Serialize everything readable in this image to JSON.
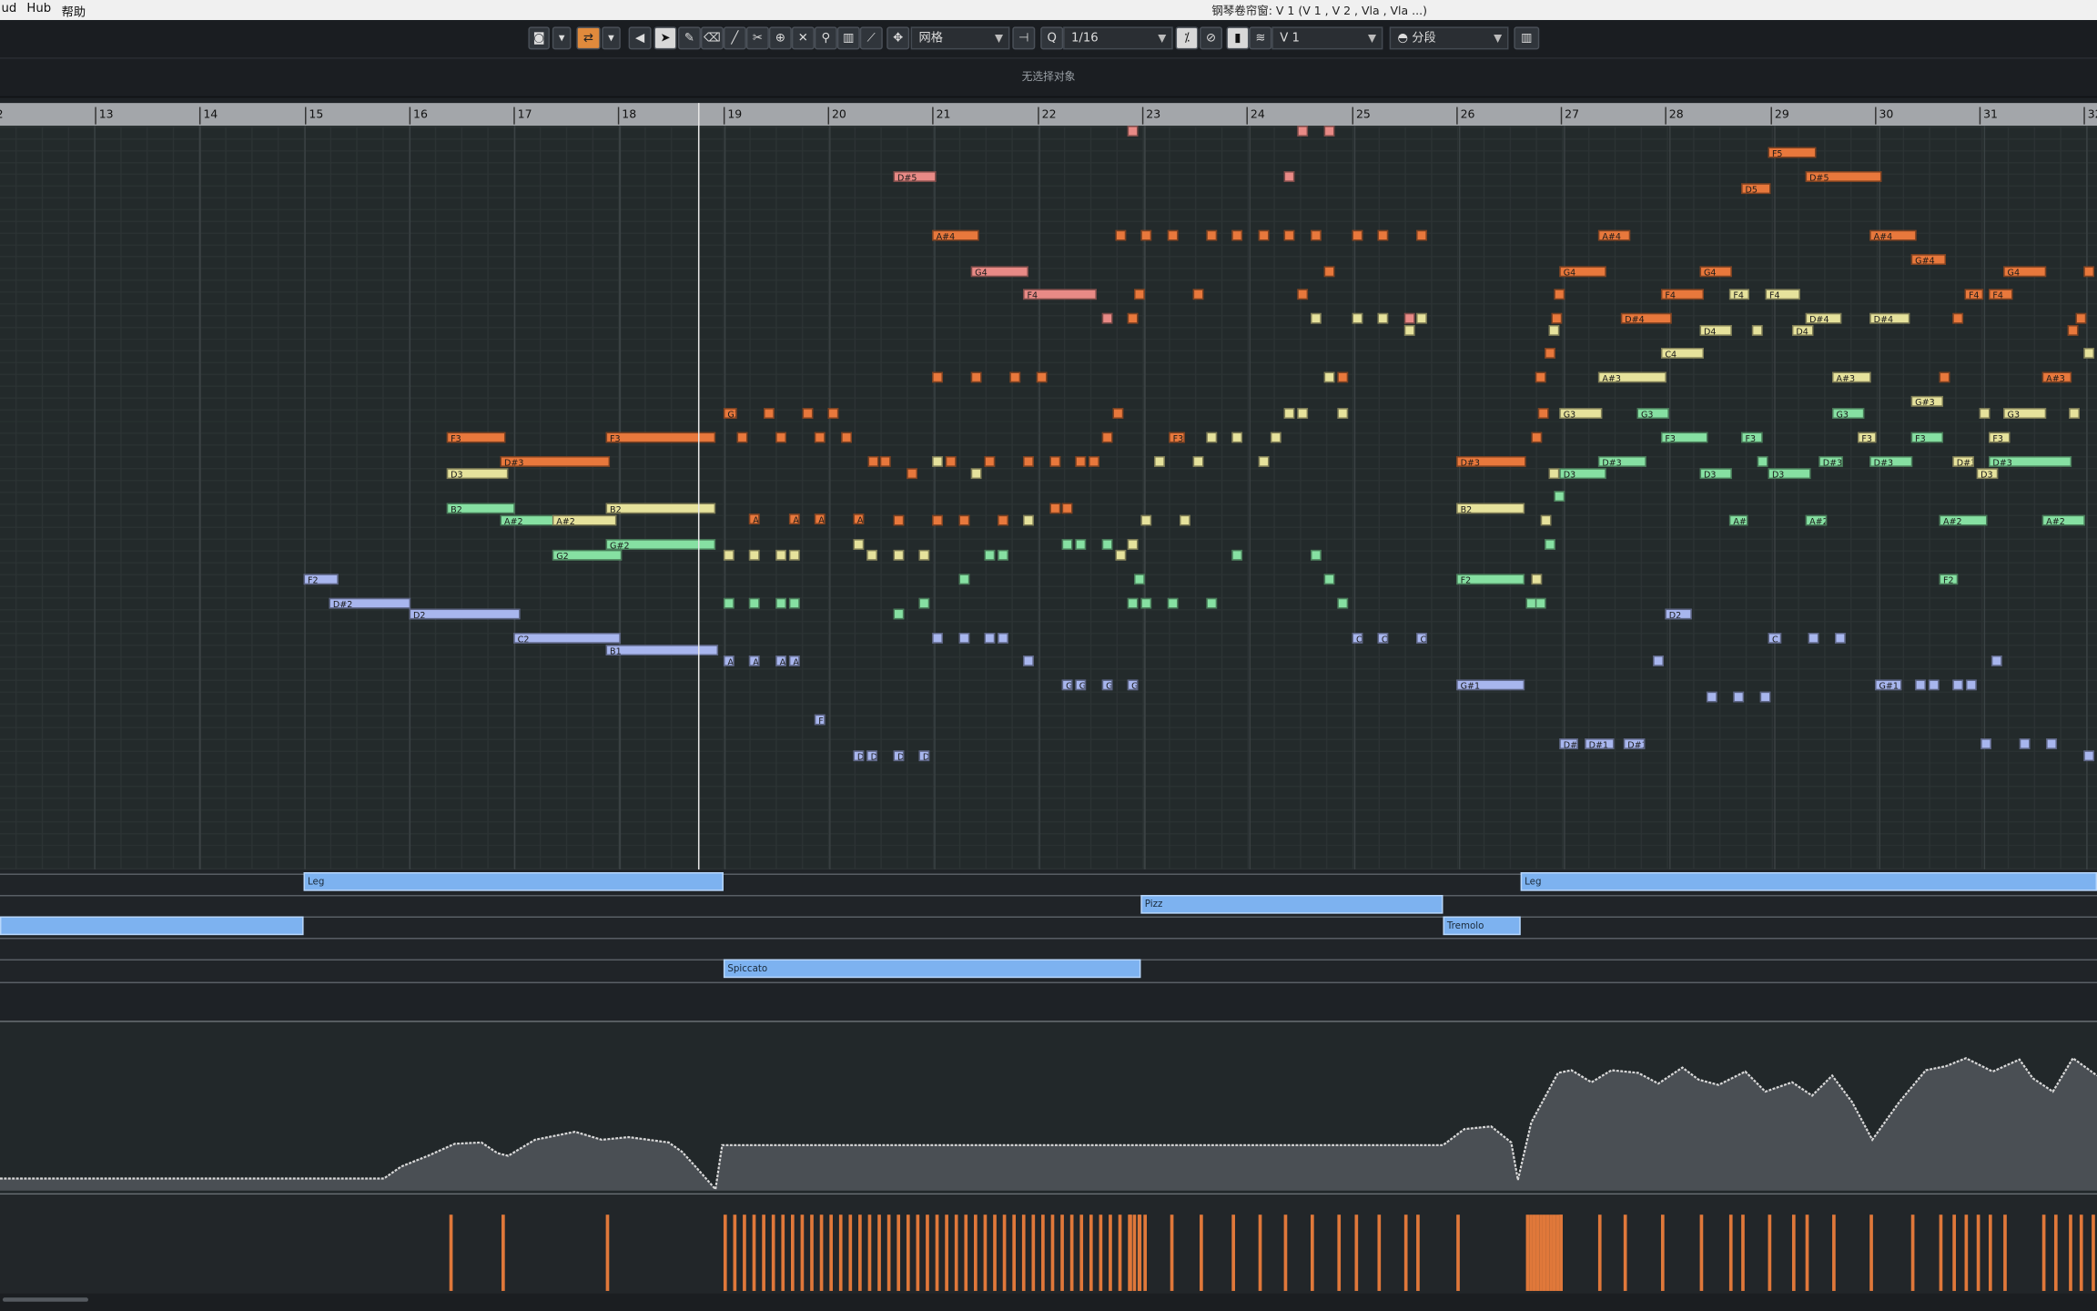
{
  "menu": {
    "items": [
      "ud",
      "Hub",
      "帮助"
    ]
  },
  "window_title": "钢琴卷帘窗: V 1 (V 1 , V 2 , Vla , Vla ...)",
  "toolbar": {
    "grid_label": "网格",
    "quantize_value": "1/16",
    "track_value": "V 1",
    "segment_label": "分段"
  },
  "info": {
    "status": "无选择对象"
  },
  "ruler": {
    "bars": [
      "2",
      "13",
      "14",
      "15",
      "16",
      "17",
      "18",
      "19",
      "20",
      "21",
      "22",
      "23",
      "24",
      "25",
      "26",
      "27",
      "28",
      "29",
      "30",
      "31",
      "32"
    ]
  },
  "articulations": {
    "labels": [
      "Leg",
      "Pizz",
      "Tremolo",
      "Spiccato",
      "Leg"
    ]
  },
  "colors": {
    "orange": "#e8783c",
    "pink": "#e88a86",
    "yellow": "#e6e29c",
    "green": "#86e0a2",
    "blue": "#a8b6ee",
    "articulation": "#7db2f0",
    "playhead": "#e8e8e8"
  },
  "notes": [
    {
      "label": "F3",
      "color": "orange"
    },
    {
      "label": "F3",
      "color": "orange"
    },
    {
      "label": "D#3",
      "color": "orange"
    },
    {
      "label": "D3",
      "color": "yellow"
    },
    {
      "label": "B2",
      "color": "green"
    },
    {
      "label": "B2",
      "color": "yellow"
    },
    {
      "label": "A#2",
      "color": "green"
    },
    {
      "label": "A#2",
      "color": "yellow"
    },
    {
      "label": "G#2",
      "color": "green"
    },
    {
      "label": "G2",
      "color": "green"
    },
    {
      "label": "F2",
      "color": "blue"
    },
    {
      "label": "D#2",
      "color": "blue"
    },
    {
      "label": "D2",
      "color": "blue"
    },
    {
      "label": "C2",
      "color": "blue"
    },
    {
      "label": "B1",
      "color": "blue"
    },
    {
      "label": "D#5",
      "color": "pink"
    },
    {
      "label": "A#4",
      "color": "orange"
    },
    {
      "label": "G4",
      "color": "pink"
    },
    {
      "label": "F4",
      "color": "pink"
    },
    {
      "label": "F5",
      "color": "orange"
    },
    {
      "label": "D#5",
      "color": "orange"
    },
    {
      "label": "D5",
      "color": "orange"
    },
    {
      "label": "A#4",
      "color": "orange"
    },
    {
      "label": "A#4",
      "color": "orange"
    },
    {
      "label": "G#4",
      "color": "orange"
    },
    {
      "label": "G4",
      "color": "orange"
    },
    {
      "label": "G4",
      "color": "orange"
    },
    {
      "label": "G4",
      "color": "orange"
    },
    {
      "label": "F4",
      "color": "orange"
    },
    {
      "label": "F4",
      "color": "yellow"
    },
    {
      "label": "F4",
      "color": "yellow"
    },
    {
      "label": "F4",
      "color": "orange"
    },
    {
      "label": "F4",
      "color": "orange"
    },
    {
      "label": "D#4",
      "color": "orange"
    },
    {
      "label": "D#4",
      "color": "yellow"
    },
    {
      "label": "D#4",
      "color": "yellow"
    },
    {
      "label": "D4",
      "color": "yellow"
    },
    {
      "label": "D4",
      "color": "yellow"
    },
    {
      "label": "C4",
      "color": "yellow"
    },
    {
      "label": "A#3",
      "color": "yellow"
    },
    {
      "label": "A#3",
      "color": "yellow"
    },
    {
      "label": "A#3",
      "color": "orange"
    },
    {
      "label": "G#3",
      "color": "yellow"
    },
    {
      "label": "G3",
      "color": "yellow"
    },
    {
      "label": "G3",
      "color": "green"
    },
    {
      "label": "G3",
      "color": "green"
    },
    {
      "label": "G3",
      "color": "yellow"
    },
    {
      "label": "F3",
      "color": "green"
    },
    {
      "label": "F3",
      "color": "green"
    },
    {
      "label": "F3",
      "color": "green"
    },
    {
      "label": "F3",
      "color": "yellow"
    },
    {
      "label": "F3",
      "color": "yellow"
    },
    {
      "label": "D#3",
      "color": "orange"
    },
    {
      "label": "D#3",
      "color": "green"
    },
    {
      "label": "D#3",
      "color": "green"
    },
    {
      "label": "D#3",
      "color": "green"
    },
    {
      "label": "D#3",
      "color": "yellow"
    },
    {
      "label": "D#3",
      "color": "green"
    },
    {
      "label": "D3",
      "color": "green"
    },
    {
      "label": "D3",
      "color": "green"
    },
    {
      "label": "D3",
      "color": "green"
    },
    {
      "label": "D3",
      "color": "yellow"
    },
    {
      "label": "B2",
      "color": "yellow"
    },
    {
      "label": "A#2",
      "color": "green"
    },
    {
      "label": "A#2",
      "color": "green"
    },
    {
      "label": "A#2",
      "color": "green"
    },
    {
      "label": "A#2",
      "color": "green"
    },
    {
      "label": "F2",
      "color": "green"
    },
    {
      "label": "F2",
      "color": "green"
    },
    {
      "label": "D2",
      "color": "blue"
    },
    {
      "label": "G#1",
      "color": "blue"
    },
    {
      "label": "G#1",
      "color": "blue"
    },
    {
      "label": "D#1",
      "color": "blue"
    },
    {
      "label": "D#1",
      "color": "blue"
    },
    {
      "label": "D#1",
      "color": "blue"
    },
    {
      "label": "G3",
      "color": "orange"
    },
    {
      "label": "F3",
      "color": "yellow"
    },
    {
      "label": "D",
      "color": "blue"
    },
    {
      "label": "D",
      "color": "blue"
    },
    {
      "label": "D",
      "color": "blue"
    },
    {
      "label": "D",
      "color": "blue"
    },
    {
      "label": "F",
      "color": "blue"
    },
    {
      "label": "A",
      "color": "orange"
    },
    {
      "label": "A",
      "color": "orange"
    },
    {
      "label": "A",
      "color": "orange"
    },
    {
      "label": "A",
      "color": "orange"
    },
    {
      "label": "A",
      "color": "blue"
    },
    {
      "label": "A",
      "color": "blue"
    },
    {
      "label": "A",
      "color": "blue"
    },
    {
      "label": "A",
      "color": "blue"
    },
    {
      "label": "G",
      "color": "blue"
    },
    {
      "label": "G",
      "color": "blue"
    },
    {
      "label": "G",
      "color": "blue"
    },
    {
      "label": "G",
      "color": "blue"
    },
    {
      "label": "C",
      "color": "blue"
    },
    {
      "label": "C",
      "color": "blue"
    },
    {
      "label": "C",
      "color": "blue"
    },
    {
      "label": "C",
      "color": "blue"
    }
  ]
}
